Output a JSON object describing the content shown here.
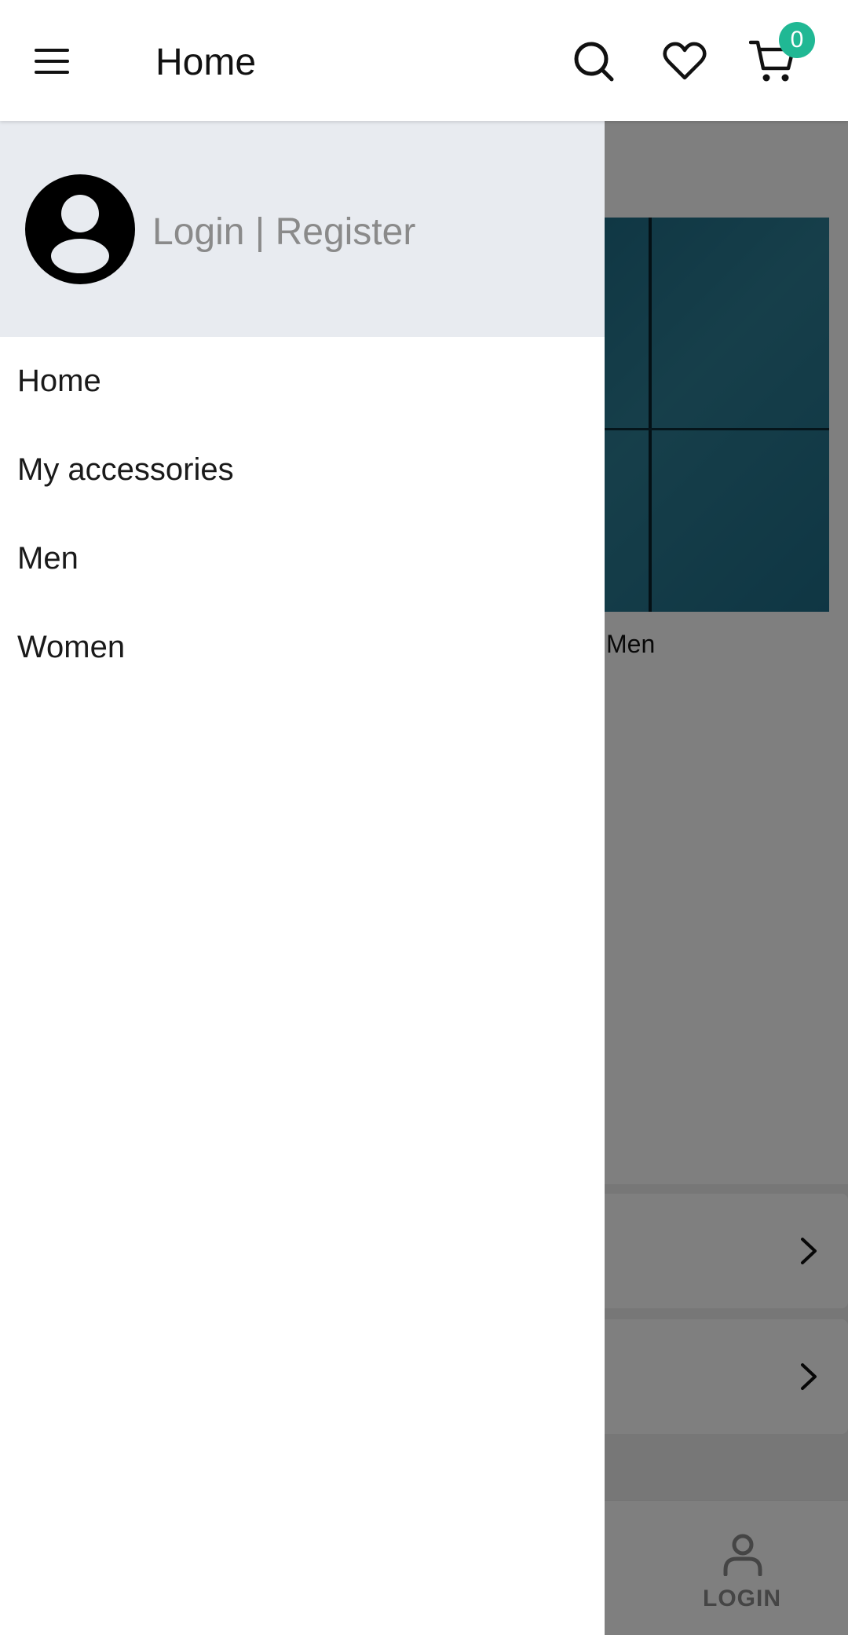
{
  "appbar": {
    "title": "Home",
    "menu_icon": "menu-icon",
    "search_icon": "search-icon",
    "wishlist_icon": "heart-icon",
    "cart_icon": "cart-icon",
    "cart_count": "0",
    "badge_color": "#20b894"
  },
  "drawer": {
    "header": {
      "avatar_icon": "account-circle-icon",
      "login_text": "Login | Register"
    },
    "items": [
      {
        "label": "Home"
      },
      {
        "label": "My accessories"
      },
      {
        "label": "Men"
      },
      {
        "label": "Women"
      }
    ]
  },
  "background": {
    "category_label": "Men",
    "bottom_nav": {
      "login_label": "LOGIN"
    }
  }
}
